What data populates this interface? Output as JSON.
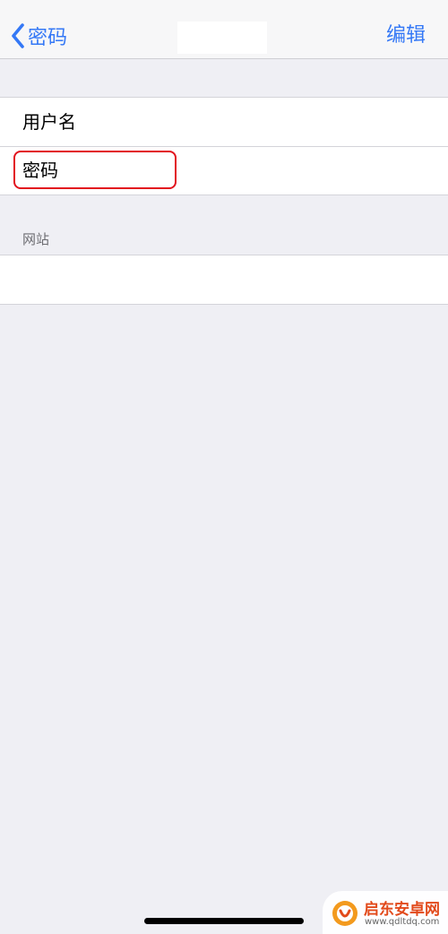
{
  "navbar": {
    "back_label": "密码",
    "edit_label": "编辑",
    "accent_color": "#3478f6"
  },
  "account_fields": [
    {
      "label": "用户名"
    },
    {
      "label": "密码"
    }
  ],
  "website_section": {
    "header": "网站",
    "value": ""
  },
  "watermark": {
    "name": "启东安卓网",
    "url": "www.qdltdq.com"
  },
  "colors": {
    "background": "#efeff4",
    "highlight": "#e2101d"
  }
}
